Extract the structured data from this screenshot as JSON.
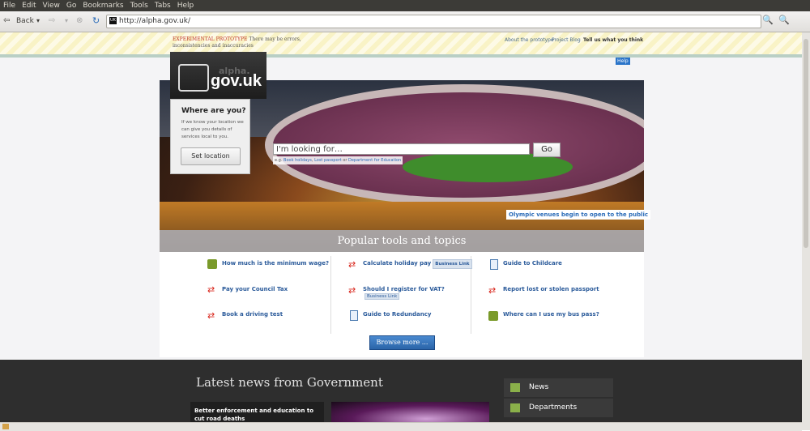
{
  "menu": [
    "File",
    "Edit",
    "View",
    "Go",
    "Bookmarks",
    "Tools",
    "Tabs",
    "Help"
  ],
  "toolbar": {
    "back_label": "Back",
    "url": "http://alpha.gov.uk/"
  },
  "banner": {
    "prototype_label": "EXPERIMENTAL PROTOTYPE",
    "prototype_text": "There may be errors, inconsistencies and inaccuracies",
    "links": [
      "About the prototype",
      "Project Blog",
      "Tell us what you think"
    ]
  },
  "logo": {
    "line1": "alpha.",
    "line2": "gov.uk"
  },
  "help_label": "Help",
  "where": {
    "heading": "Where are you?",
    "text": "If we know your location we can give you details of services local to you.",
    "button": "Set location"
  },
  "search": {
    "placeholder": "I'm looking for…",
    "go_label": "Go",
    "eg_prefix": "e.g.",
    "examples": [
      "Book holidays",
      "Lost passport",
      "Department for Education"
    ],
    "or_word": "or"
  },
  "hero_caption": "Olympic venues begin to open to the public",
  "popular_title": "Popular tools and topics",
  "links": [
    {
      "text": "How much is the minimum wage?",
      "icon": "question-bubble-icon"
    },
    {
      "text": "Pay your Council Tax",
      "icon": "exchange-arrows-icon"
    },
    {
      "text": "Book a driving test",
      "icon": "exchange-arrows-icon"
    },
    {
      "text": "Calculate holiday pay",
      "icon": "exchange-arrows-icon",
      "badge": "Business Link"
    },
    {
      "text": "Should I register for VAT?",
      "icon": "exchange-arrows-icon",
      "badge": "Business Link"
    },
    {
      "text": "Guide to Redundancy",
      "icon": "document-icon"
    },
    {
      "text": "Guide to Childcare",
      "icon": "document-icon"
    },
    {
      "text": "Report lost or stolen passport",
      "icon": "exchange-arrows-icon"
    },
    {
      "text": "Where can I use my bus pass?",
      "icon": "question-bubble-icon"
    }
  ],
  "browse_label": "Browse more ...",
  "news": {
    "heading": "Latest news from Government",
    "card_title": "Better enforcement and education to cut road deaths"
  },
  "side_nav": [
    "News",
    "Departments"
  ]
}
